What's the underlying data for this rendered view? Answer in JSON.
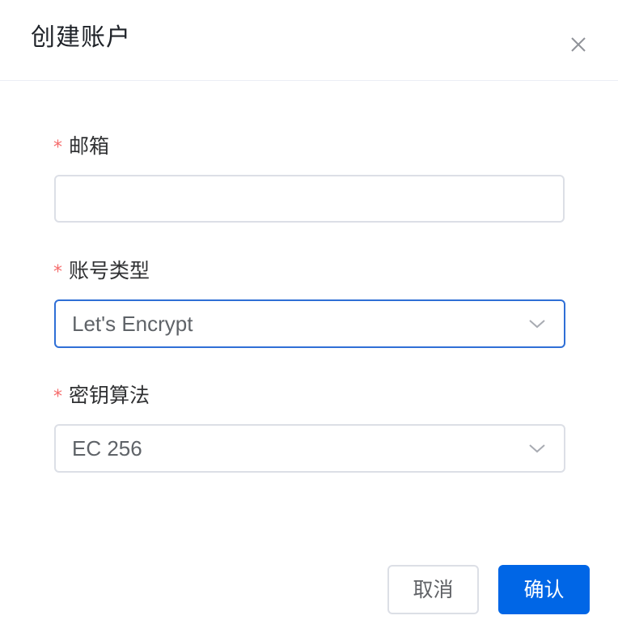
{
  "dialog": {
    "title": "创建账户"
  },
  "form": {
    "email": {
      "label": "邮箱",
      "required_mark": "*",
      "value": "",
      "placeholder": ""
    },
    "account_type": {
      "label": "账号类型",
      "required_mark": "*",
      "selected": "Let's Encrypt"
    },
    "key_algorithm": {
      "label": "密钥算法",
      "required_mark": "*",
      "selected": "EC 256"
    }
  },
  "footer": {
    "cancel_label": "取消",
    "confirm_label": "确认"
  },
  "icons": {
    "close": "close-icon",
    "dropdown": "chevron-down-icon"
  },
  "colors": {
    "primary": "#0066e6",
    "focus_border": "#2f6fd6",
    "required": "#f56c6c",
    "border": "#dcdfe6"
  }
}
